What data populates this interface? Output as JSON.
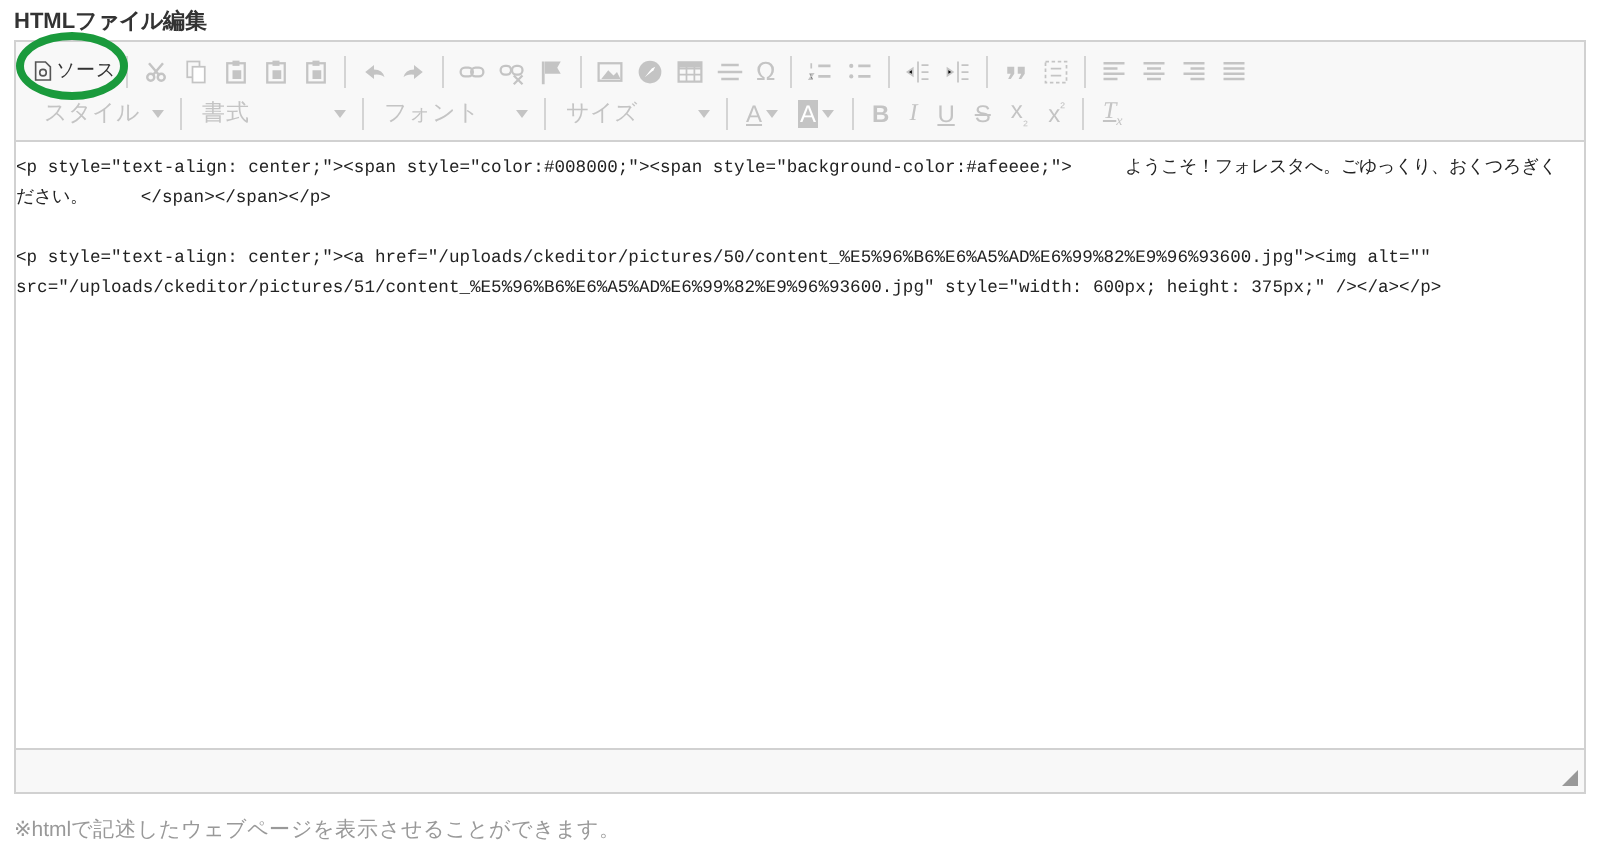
{
  "title": "HTMLファイル編集",
  "toolbar": {
    "icons_disabled": true,
    "source_button": {
      "label": "ソース",
      "disabled": false
    },
    "symbol_button": {
      "label": "Ω",
      "disabled": true
    },
    "dropdowns": [
      {
        "label": "スタイル",
        "disabled": true
      },
      {
        "label": "書式",
        "disabled": true
      },
      {
        "label": "フォント",
        "disabled": true
      },
      {
        "label": "サイズ",
        "disabled": true
      }
    ],
    "format_buttons": [
      {
        "label": "A",
        "kind": "text-color",
        "disabled": true
      },
      {
        "label": "A",
        "kind": "background-color",
        "disabled": true
      },
      {
        "label": "B",
        "kind": "bold",
        "disabled": true
      },
      {
        "label": "I",
        "kind": "italic",
        "disabled": true
      },
      {
        "label": "U",
        "kind": "underline",
        "disabled": true
      },
      {
        "label": "S",
        "kind": "strike",
        "disabled": true
      },
      {
        "label": "x$_{₂}$",
        "kind": "subscript",
        "disabled": true
      },
      {
        "label": "x$^{²}$",
        "kind": "superscript",
        "disabled": true
      },
      {
        "label": "T$_{x}$",
        "kind": "clear",
        "disabled": true
      }
    ]
  },
  "source_lines": [
    "<p style=\"text-align: center;\"><span style=\"color:#008000;\"><span style=\"background-color:#afeeee;\">     ようこそ！フォレスタへ。ごゆっくり、おくつろぎく",
    "ださい。     </span></span></p>",
    "<p style=\"text-align: center;\"><a href=\"/uploads/ckeditor/pictures/50/content_%E5%96%B6%E6%A5%AD%E6%99%82%E9%96%93600.jpg\"><img alt=\"\"",
    "src=\"/uploads/ckeditor/pictures/51/content_%E5%96%B6%E6%A5%AD%E6%99%82%E9%96%93600.jpg\" style=\"width: 600px; height: 375px;\" /></a></p>"
  ],
  "note": "※htmlで記述したウェブページを表示させることができます。",
  "highlight": {
    "color": "#1a9a3c"
  }
}
